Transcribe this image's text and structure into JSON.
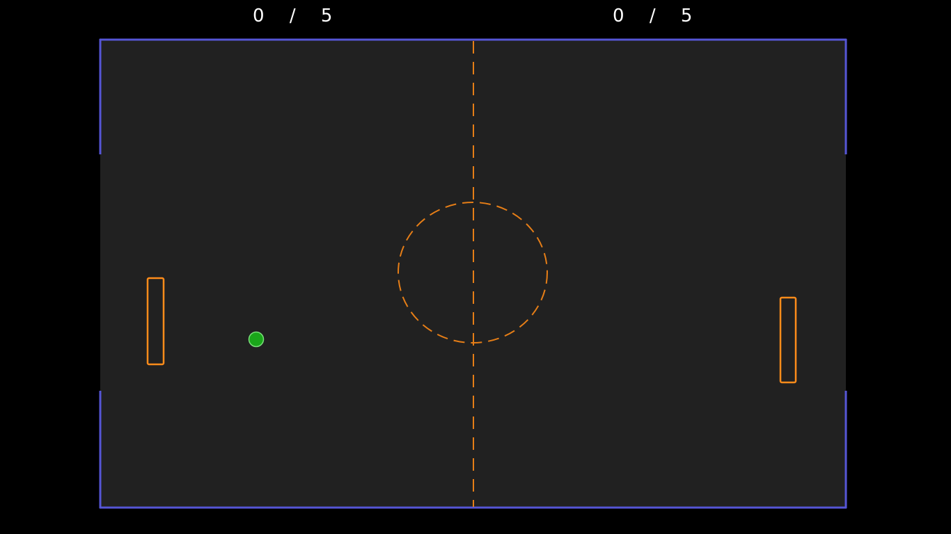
{
  "scores": {
    "left": {
      "value": "0",
      "separator": "/",
      "limit": "5"
    },
    "right": {
      "value": "0",
      "separator": "/",
      "limit": "5"
    }
  },
  "colors": {
    "background": "#000000",
    "field": "#212121",
    "walls": "#5656d6",
    "markings": "#e67e17",
    "paddles": "#ff8c1a",
    "ball": "#1aa61a",
    "ball_outline": "#7be07b",
    "score_text": "#ffffff"
  }
}
